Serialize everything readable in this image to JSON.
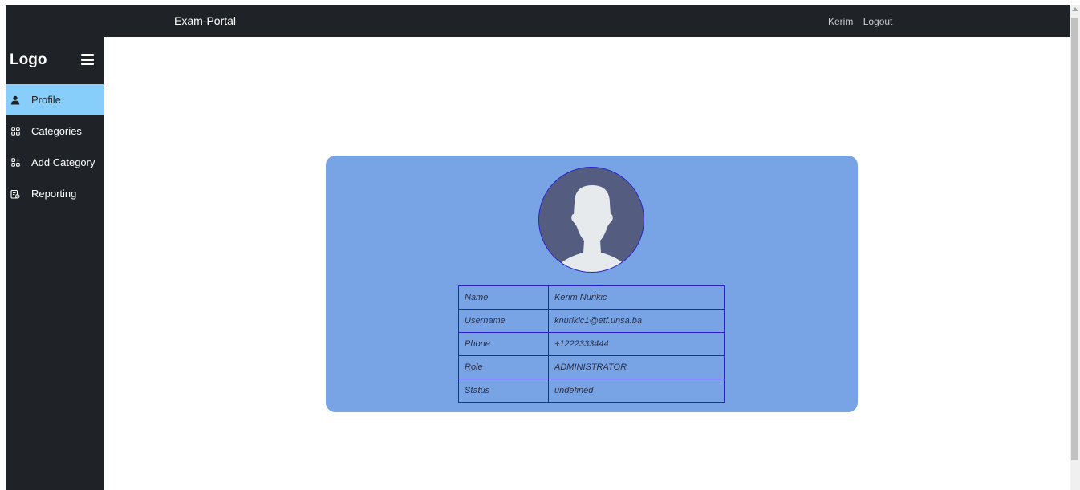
{
  "navbar": {
    "brand": "Exam-Portal",
    "user": "Kerim",
    "logout": "Logout"
  },
  "sidebar": {
    "logo": "Logo",
    "menu_icon": "hamburger-menu-icon",
    "items": [
      {
        "label": "Profile",
        "icon": "user-icon",
        "active": true
      },
      {
        "label": "Categories",
        "icon": "grid-icon",
        "active": false
      },
      {
        "label": "Add Category",
        "icon": "grid-add-icon",
        "active": false
      },
      {
        "label": "Reporting",
        "icon": "report-icon",
        "active": false
      }
    ]
  },
  "profile": {
    "avatar": "default-user-avatar",
    "rows": [
      {
        "key": "Name",
        "value": "Kerim Nurikic"
      },
      {
        "key": "Username",
        "value": "knurikic1@etf.unsa.ba"
      },
      {
        "key": "Phone",
        "value": "+1222333444"
      },
      {
        "key": "Role",
        "value": "ADMINISTRATOR"
      },
      {
        "key": "Status",
        "value": "undefined"
      }
    ]
  },
  "colors": {
    "navbar_bg": "#1f2327",
    "active_item_bg": "#87cefa",
    "card_bg": "#78a4e6",
    "table_border": "#2a1fc8"
  }
}
